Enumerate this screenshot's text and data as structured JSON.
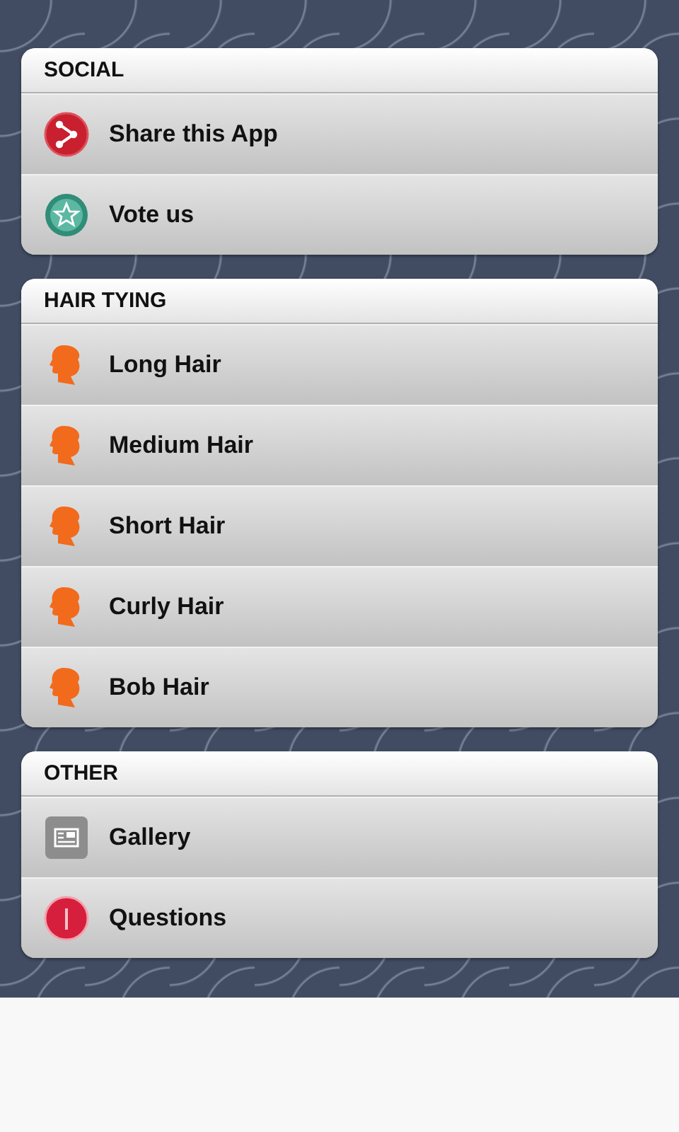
{
  "sections": [
    {
      "title": "SOCIAL",
      "items": [
        {
          "label": "Share this App",
          "kind": "share"
        },
        {
          "label": "Vote us",
          "kind": "star"
        }
      ]
    },
    {
      "title": "HAIR TYING",
      "items": [
        {
          "label": "Long Hair",
          "kind": "hair"
        },
        {
          "label": "Medium Hair",
          "kind": "hair"
        },
        {
          "label": "Short Hair",
          "kind": "hair"
        },
        {
          "label": "Curly Hair",
          "kind": "hair"
        },
        {
          "label": "Bob Hair",
          "kind": "hair"
        }
      ]
    },
    {
      "title": "OTHER",
      "items": [
        {
          "label": "Gallery",
          "kind": "gallery"
        },
        {
          "label": "Questions",
          "kind": "info"
        }
      ]
    }
  ]
}
